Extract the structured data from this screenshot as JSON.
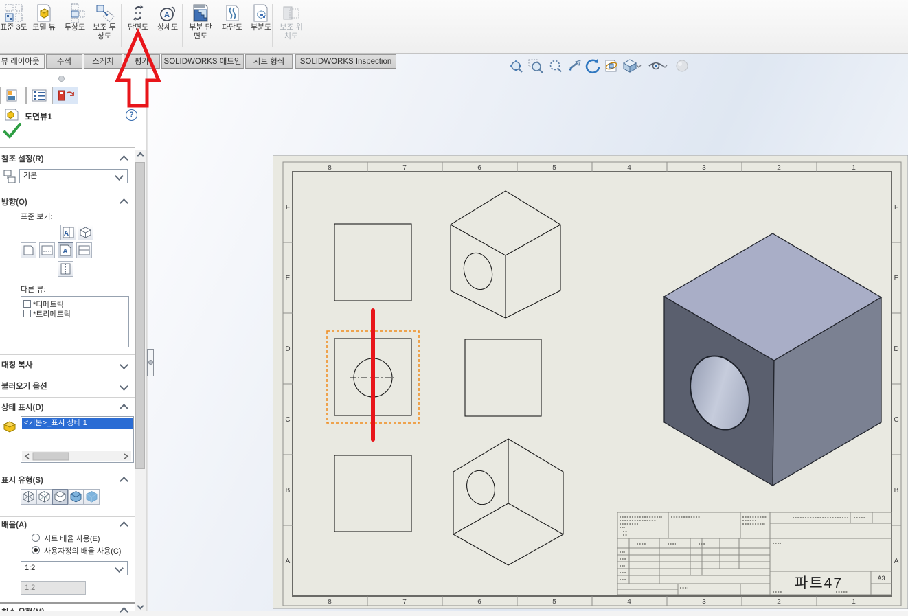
{
  "ribbon": {
    "items": [
      {
        "id": "standard-3-view",
        "label": "표준 3도",
        "enabled": true
      },
      {
        "id": "model-view",
        "label": "모델 뷰",
        "enabled": true
      },
      {
        "id": "projected-view",
        "label": "투상도",
        "enabled": true
      },
      {
        "id": "auxiliary-view",
        "label": "보조 투 상도",
        "enabled": true
      },
      {
        "id": "section-view",
        "label": "단면도",
        "enabled": true
      },
      {
        "id": "detail-view",
        "label": "상세도",
        "enabled": true,
        "icon_letter": "A"
      },
      {
        "id": "broken-out-section",
        "label": "부분 단 면도",
        "enabled": true
      },
      {
        "id": "break-view",
        "label": "파단도",
        "enabled": true
      },
      {
        "id": "crop-view",
        "label": "부분도",
        "enabled": true
      },
      {
        "id": "alternate-position-view",
        "label": "보조 위 치도",
        "enabled": false
      }
    ]
  },
  "tabs": {
    "items": [
      {
        "label": "뷰 레이아웃",
        "active": true
      },
      {
        "label": "주석",
        "active": false
      },
      {
        "label": "스케치",
        "active": false
      },
      {
        "label": "평가",
        "active": false
      },
      {
        "label": "SOLIDWORKS 애드인",
        "active": false
      },
      {
        "label": "시트 형식",
        "active": false
      },
      {
        "label": "SOLIDWORKS Inspection",
        "active": false
      }
    ]
  },
  "headsup": {
    "icons": [
      "zoom-to-fit",
      "zoom-to-area",
      "zoom-in-out",
      "previous-view",
      "rotate-view",
      "3d-drawing-view",
      "view-orientation",
      "hide-show-items",
      "appearances"
    ]
  },
  "property_panel": {
    "title": "도면뷰1",
    "help_glyph": "?",
    "reference": {
      "label": "참조 설정(R)",
      "config_value": "기본"
    },
    "orientation": {
      "label": "방향(O)",
      "standard_views_label": "표준 보기:",
      "view_letter": "A",
      "other_views_label": "다른 뷰:",
      "other_views": [
        "*디메트릭",
        "*트리메트릭"
      ]
    },
    "mirror": {
      "label": "대칭 복사"
    },
    "import_options": {
      "label": "불러오기 옵션"
    },
    "display_state": {
      "label": "상태 표시(D)",
      "selected": "<기본>_표시 상태 1"
    },
    "display_style": {
      "label": "표시 유형(S)"
    },
    "scale": {
      "label": "배율(A)",
      "radio_sheet": "시트 배율 사용(E)",
      "radio_custom": "사용자정의 배율 사용(C)",
      "combo_value": "1:2",
      "input_value": "1:2"
    },
    "dimension_type": {
      "label": "치수 유형(M)"
    }
  },
  "sheet": {
    "ruler_columns": [
      "8",
      "7",
      "6",
      "5",
      "4",
      "3",
      "2",
      "1"
    ],
    "ruler_rows": [
      "F",
      "E",
      "D",
      "C",
      "B",
      "A"
    ],
    "title_block": {
      "part_name": "파트47",
      "sheet_size": "A3"
    }
  },
  "colors": {
    "annotation_red": "#e8151a",
    "paper": "#e9e9e1",
    "cube_top": "#a9aec7",
    "cube_left": "#5a5f6e",
    "cube_right": "#7b8192",
    "selection_orange": "#f08c1e",
    "highlight_blue": "#2a6cd4"
  }
}
